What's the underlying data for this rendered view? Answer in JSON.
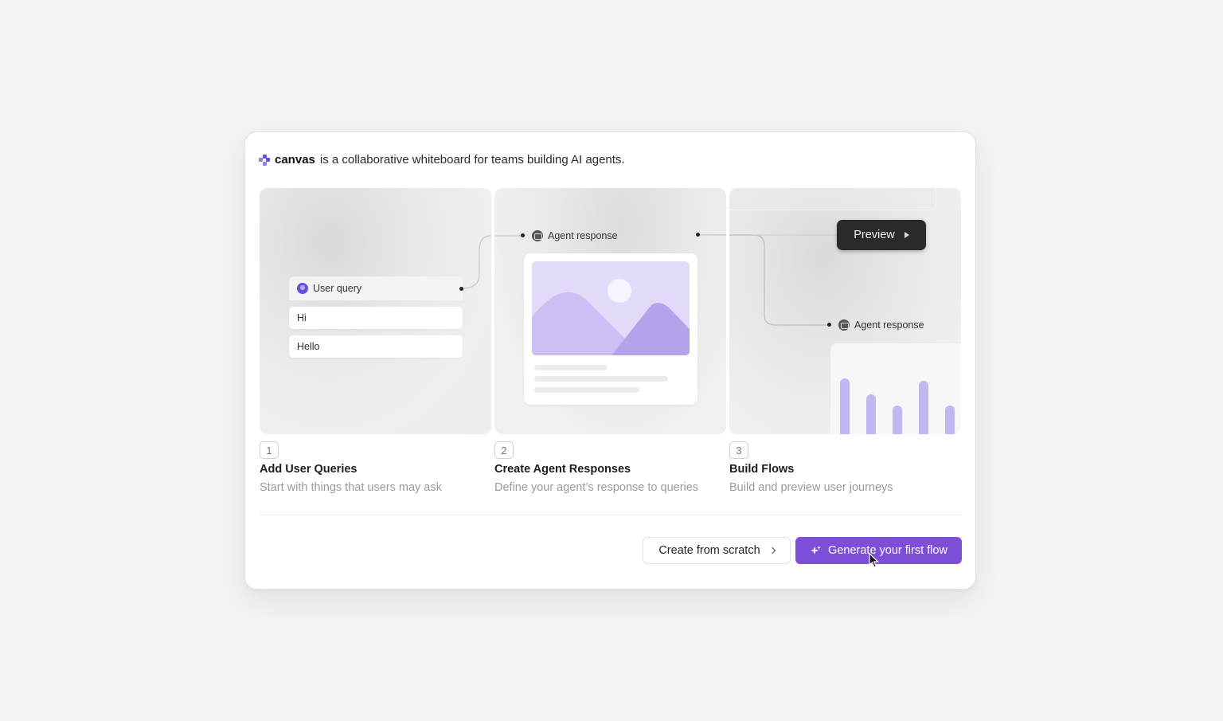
{
  "header": {
    "brand": "canvas",
    "tagline": "is a collaborative whiteboard for teams building AI agents."
  },
  "steps": [
    {
      "number": "1",
      "title": "Add User Queries",
      "description": "Start with things that users may ask",
      "illustration": {
        "node_label": "User query",
        "queries": [
          "Hi",
          "Hello"
        ]
      }
    },
    {
      "number": "2",
      "title": "Create Agent Responses",
      "description": "Define your agent’s response to queries",
      "illustration": {
        "node_label": "Agent response"
      }
    },
    {
      "number": "3",
      "title": "Build Flows",
      "description": "Build and preview user journeys",
      "illustration": {
        "preview_label": "Preview",
        "node_label": "Agent response",
        "bar_levels": [
          0.78,
          0.6,
          0.47,
          0.75,
          0.47
        ]
      }
    }
  ],
  "footer": {
    "create_from_scratch": "Create from scratch",
    "generate_first_flow": "Generate your first flow"
  },
  "colors": {
    "accent": "#7d4fd9",
    "illustration_purple": "#c4b6f0",
    "preview_button": "#2a2a2a"
  },
  "icons": {
    "logo": "canvas-logo-icon",
    "user_query": "user-avatar-icon",
    "agent_response": "bot-icon",
    "preview": "play-icon",
    "create_chevron": "chevron-right-icon",
    "generate": "sparkle-icon"
  }
}
